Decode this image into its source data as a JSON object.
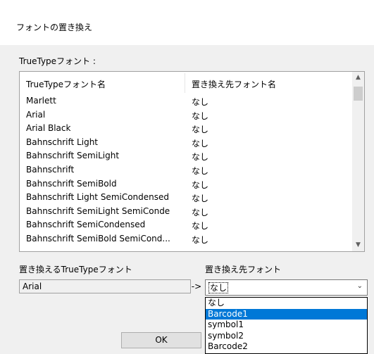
{
  "window": {
    "title": "フォントの置き換え"
  },
  "section": {
    "label": "TrueTypeフォント :"
  },
  "list": {
    "columns": [
      "TrueTypeフォント名",
      "置き換え先フォント名"
    ],
    "rows": [
      [
        "Marlett",
        "なし"
      ],
      [
        "Arial",
        "なし"
      ],
      [
        "Arial Black",
        "なし"
      ],
      [
        "Bahnschrift Light",
        "なし"
      ],
      [
        "Bahnschrift SemiLight",
        "なし"
      ],
      [
        "Bahnschrift",
        "なし"
      ],
      [
        "Bahnschrift SemiBold",
        "なし"
      ],
      [
        "Bahnschrift Light SemiCondensed",
        "なし"
      ],
      [
        "Bahnschrift SemiLight SemiConde",
        "なし"
      ],
      [
        "Bahnschrift SemiCondensed",
        "なし"
      ],
      [
        "Bahnschrift SemiBold SemiCond...",
        "なし"
      ]
    ]
  },
  "replace": {
    "from_label": "置き換えるTrueTypeフォント",
    "from_value": "Arial",
    "arrow": "->",
    "to_label": "置き換え先フォント",
    "to_value": "なし",
    "options": [
      "なし",
      "Barcode1",
      "symbol1",
      "symbol2",
      "Barcode2"
    ],
    "selected_option": "Barcode1"
  },
  "buttons": {
    "ok": "OK"
  },
  "icons": {
    "scroll_up": "chevron-up-icon",
    "scroll_down": "chevron-down-icon",
    "combo_caret": "chevron-down-icon"
  },
  "colors": {
    "selection": "#0078d7",
    "dialog_bg": "#f0f0f0"
  }
}
